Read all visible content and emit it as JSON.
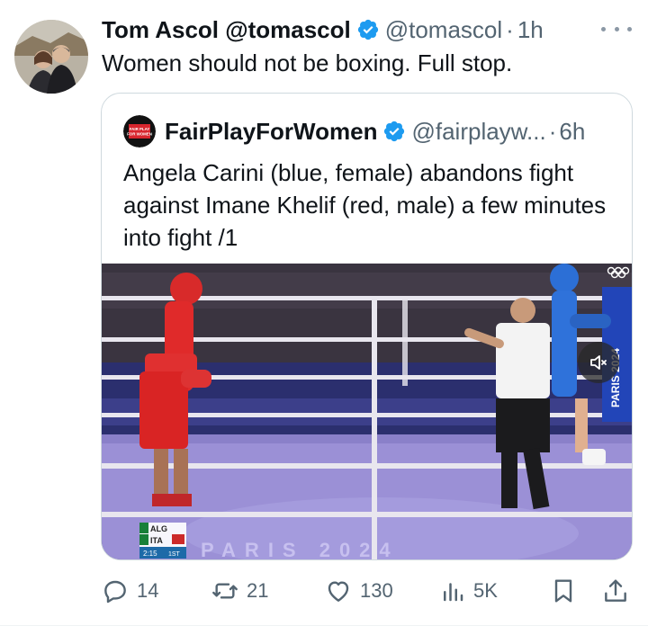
{
  "tweet": {
    "author_name": "Tom Ascol @tomascol",
    "author_handle": "@tomascol",
    "separator": "·",
    "time": "1h",
    "text": "Women should not be boxing. Full stop."
  },
  "quoted_tweet": {
    "author_name": "FairPlayForWomen",
    "author_handle": "@fairplayw...",
    "separator": "·",
    "time": "6h",
    "text": "Angela Carini (blue, female) abandons fight against Imane Khelif (red, male)  a few minutes into fight /1",
    "avatar_text": "FAIR PLAY FOR WOMEN",
    "media": {
      "banner_text": "PARIS 2024",
      "scoreboard": {
        "row1": "ALG",
        "row2": "ITA",
        "clock": "2:15",
        "round": "1ST"
      },
      "floor_text": "PARIS 2024"
    }
  },
  "actions": {
    "reply_count": "14",
    "retweet_count": "21",
    "like_count": "130",
    "views_count": "5K"
  },
  "colors": {
    "accent": "#1d9bf0",
    "text_secondary": "#536471",
    "border": "#cfd9de"
  },
  "icons": [
    "verified-badge-icon",
    "more-icon",
    "reply-icon",
    "retweet-icon",
    "like-icon",
    "views-icon",
    "bookmark-icon",
    "share-icon",
    "mute-icon"
  ]
}
